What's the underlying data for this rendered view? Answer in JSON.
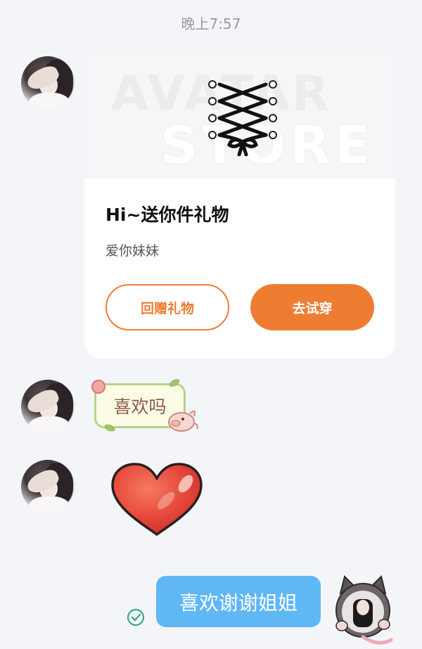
{
  "timestamp": "晚上7:57",
  "gift_card": {
    "watermark_line1": "AVATAR",
    "watermark_line2": "STORE",
    "title": "Hi~送你件礼物",
    "subtitle": "爱你妹妹",
    "return_gift_label": "回赠礼物",
    "try_on_label": "去试穿"
  },
  "sticker_message": {
    "text": "喜欢吗"
  },
  "heart_sticker": {
    "icon": "heart-sticker-icon"
  },
  "my_message": {
    "text": "喜欢谢谢姐姐",
    "status": "sent"
  },
  "colors": {
    "accent_orange": "#ef7d31",
    "bubble_blue": "#5fb7f5",
    "sent_check_green": "#3aa88a",
    "background": "#f4f5f9"
  }
}
